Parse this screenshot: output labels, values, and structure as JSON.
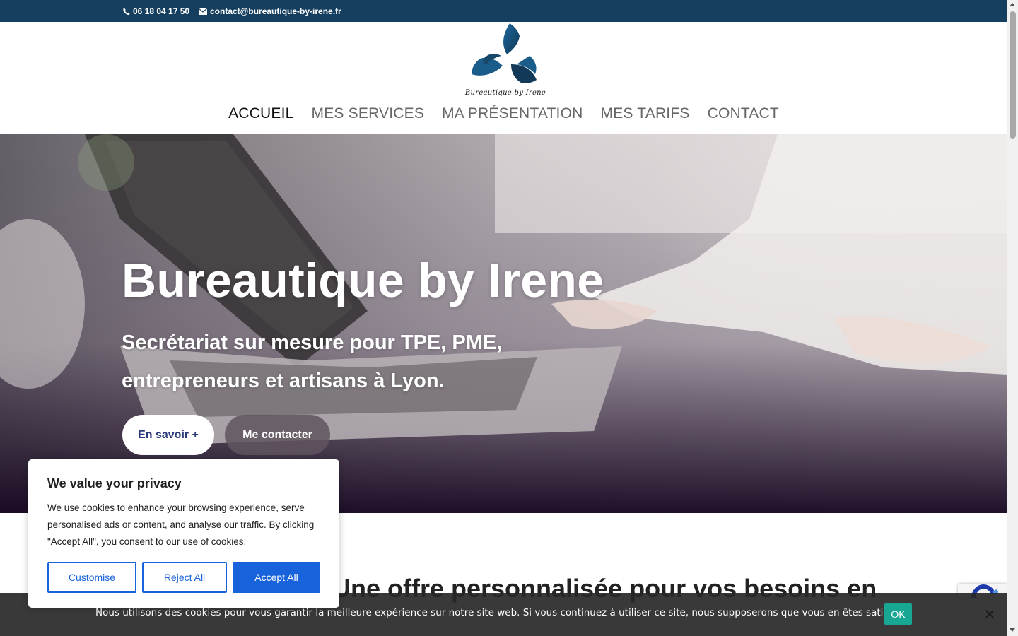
{
  "topbar": {
    "phone": "06 18 04 17 50",
    "email": "contact@bureautique-by-irene.fr",
    "background": "#163f5f"
  },
  "header": {
    "logo_text": "Bureautique by Irene",
    "nav": [
      {
        "label": "ACCUEIL",
        "active": true
      },
      {
        "label": "MES SERVICES",
        "active": false
      },
      {
        "label": "MA PRÉSENTATION",
        "active": false
      },
      {
        "label": "MES TARIFS",
        "active": false
      },
      {
        "label": "CONTACT",
        "active": false
      }
    ]
  },
  "hero": {
    "title": "Bureautique by Irene",
    "subtitle": "Secrétariat sur mesure pour TPE, PME, entrepreneurs et artisans à Lyon.",
    "buttons": {
      "more": "En savoir +",
      "contact": "Me contacter"
    }
  },
  "section": {
    "heading": "Une offre personnalisée pour vos besoins en"
  },
  "privacy_modal": {
    "title": "We value your privacy",
    "text": "We use cookies to enhance your browsing experience, serve personalised ads or content, and analyse our traffic. By clicking \"Accept All\", you consent to our use of cookies.",
    "buttons": {
      "customise": "Customise",
      "reject": "Reject All",
      "accept": "Accept All"
    },
    "accent": "#1863dc"
  },
  "cookie_bar": {
    "message": "Nous utilisons des cookies pour vous garantir la meilleure expérience sur notre site web. Si vous continuez à utiliser ce site, nous supposerons que vous en êtes satisfait.",
    "ok_label": "OK",
    "ok_color": "#17a793"
  }
}
